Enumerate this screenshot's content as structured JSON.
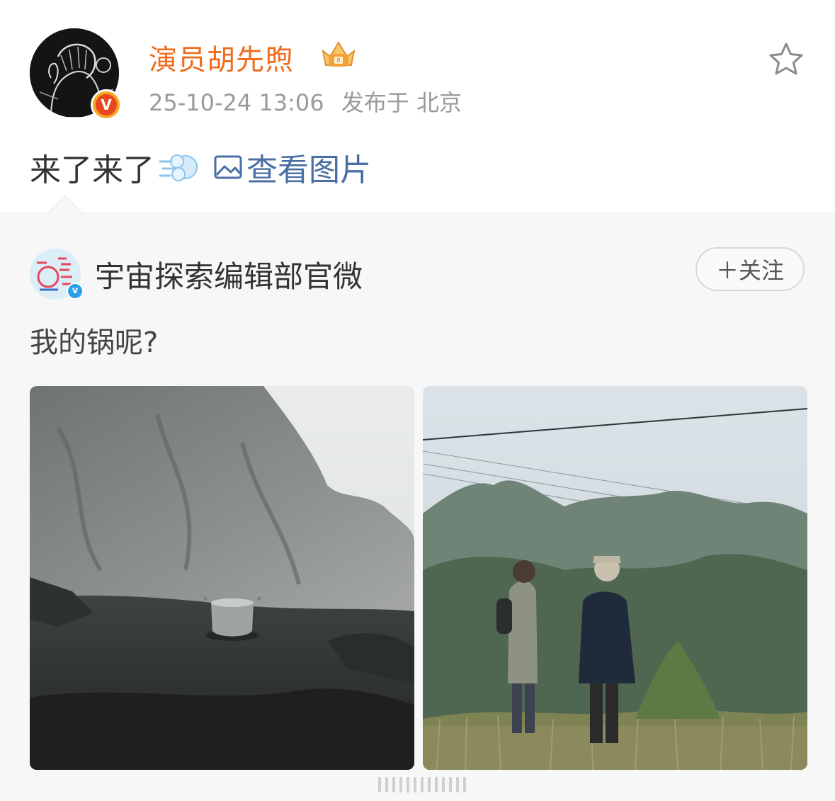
{
  "post": {
    "author": "演员胡先煦",
    "timestamp": "25-10-24 13:06",
    "location": "发布于 北京",
    "text": "来了来了",
    "view_images": "查看图片"
  },
  "repost": {
    "author": "宇宙探索编辑部官微",
    "follow_label": "＋关注",
    "text": "我的锅呢?"
  },
  "icons": {
    "favorite": "star-outline-icon",
    "verified": "verified-v-icon",
    "member": "crown-icon",
    "emoji": "dash-puff-emoji-icon",
    "images": "image-icon"
  },
  "colors": {
    "author_name": "#f06b1b",
    "link": "#4a6fa5",
    "meta": "#9a9a9a",
    "repost_bg": "#f7f7f7"
  }
}
